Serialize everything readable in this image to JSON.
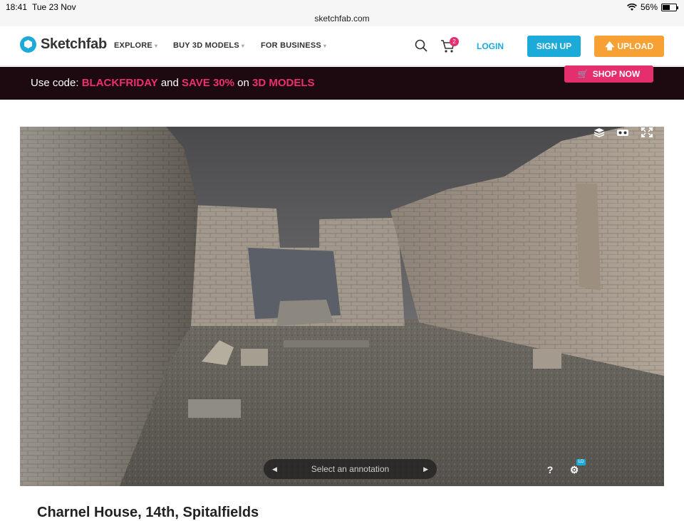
{
  "status_bar": {
    "time": "18:41",
    "date": "Tue 23 Nov",
    "url": "sketchfab.com",
    "battery": "56%",
    "battery_level": 0.56
  },
  "nav": {
    "logo_text": "Sketchfab",
    "menu": [
      {
        "label": "EXPLORE"
      },
      {
        "label": "BUY 3D MODELS"
      },
      {
        "label": "FOR BUSINESS"
      }
    ],
    "cart_count": "2",
    "login": "LOGIN",
    "signup": "SIGN UP",
    "upload": "UPLOAD"
  },
  "banner": {
    "prefix": "Use code: ",
    "code": "BLACKFRIDAY",
    "and": " and ",
    "save": "SAVE 30%",
    "on": " on ",
    "target": "3D MODELS",
    "cta": "SHOP NOW"
  },
  "viewer": {
    "annotation_placeholder": "Select an annotation",
    "ld_badge": "LD"
  },
  "model": {
    "title": "Charnel House, 14th, Spitalfields"
  },
  "colors": {
    "brand": "#1caad9",
    "upload": "#f7a134",
    "promo": "#e52e6e",
    "banner_bg": "#1c0a10"
  }
}
